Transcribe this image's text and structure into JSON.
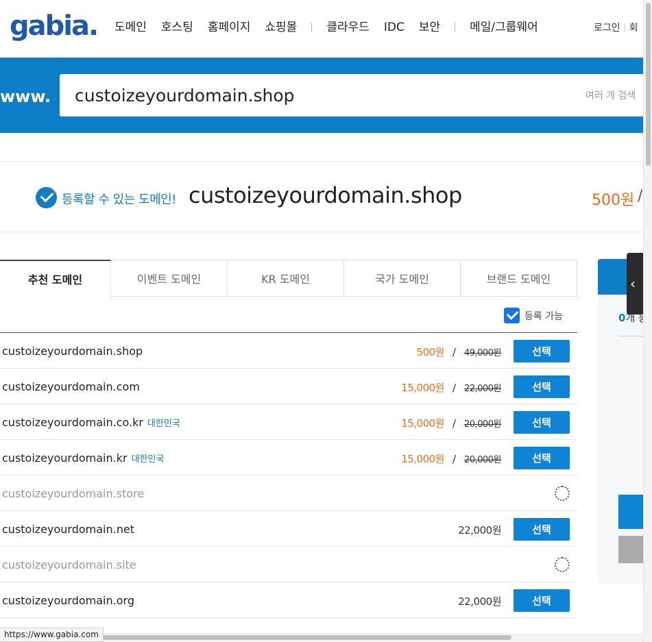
{
  "header": {
    "logo": "gabia.",
    "nav": [
      "도메인",
      "호스팅",
      "홈페이지",
      "쇼핑몰",
      "클라우드",
      "IDC",
      "보안",
      "메일/그룹웨어"
    ],
    "login": "로그인",
    "signup": "회"
  },
  "search": {
    "prefix": "www.",
    "query": "custoizeyourdomain.shop",
    "multi_search": "여러 개 검색"
  },
  "result": {
    "status": "등록할 수 있는 도메인!",
    "domain": "custoizeyourdomain.shop",
    "price": "500원",
    "slash": "/"
  },
  "tabs": [
    "추천 도메인",
    "이벤트 도메인",
    "KR 도메인",
    "국가 도메인",
    "브랜드 도메인"
  ],
  "filter": {
    "label": "등록 가능",
    "checked": true
  },
  "list": [
    {
      "name": "custoizeyourdomain.shop",
      "country": "",
      "price": "500원",
      "old": "49,000원",
      "action": "선택"
    },
    {
      "name": "custoizeyourdomain.com",
      "country": "",
      "price": "15,000원",
      "old": "22,000원",
      "action": "선택"
    },
    {
      "name": "custoizeyourdomain.co.kr",
      "country": "대한민국",
      "price": "15,000원",
      "old": "20,000원",
      "action": "선택"
    },
    {
      "name": "custoizeyourdomain.kr",
      "country": "대한민국",
      "price": "15,000원",
      "old": "20,000원",
      "action": "선택"
    },
    {
      "name": "custoizeyourdomain.store",
      "state": "loading"
    },
    {
      "name": "custoizeyourdomain.net",
      "price_plain": "22,000원",
      "action": "선택"
    },
    {
      "name": "custoizeyourdomain.site",
      "state": "loading"
    },
    {
      "name": "custoizeyourdomain.org",
      "price_plain": "22,000원",
      "action": "선택"
    }
  ],
  "cart": {
    "count_num": "0",
    "count_suffix": "개 등"
  },
  "statusbar": "https://www.gabia.com",
  "colors": {
    "brand_blue": "#0f7ec8",
    "price_orange": "#f26b1d",
    "button_blue": "#0f84d4"
  }
}
